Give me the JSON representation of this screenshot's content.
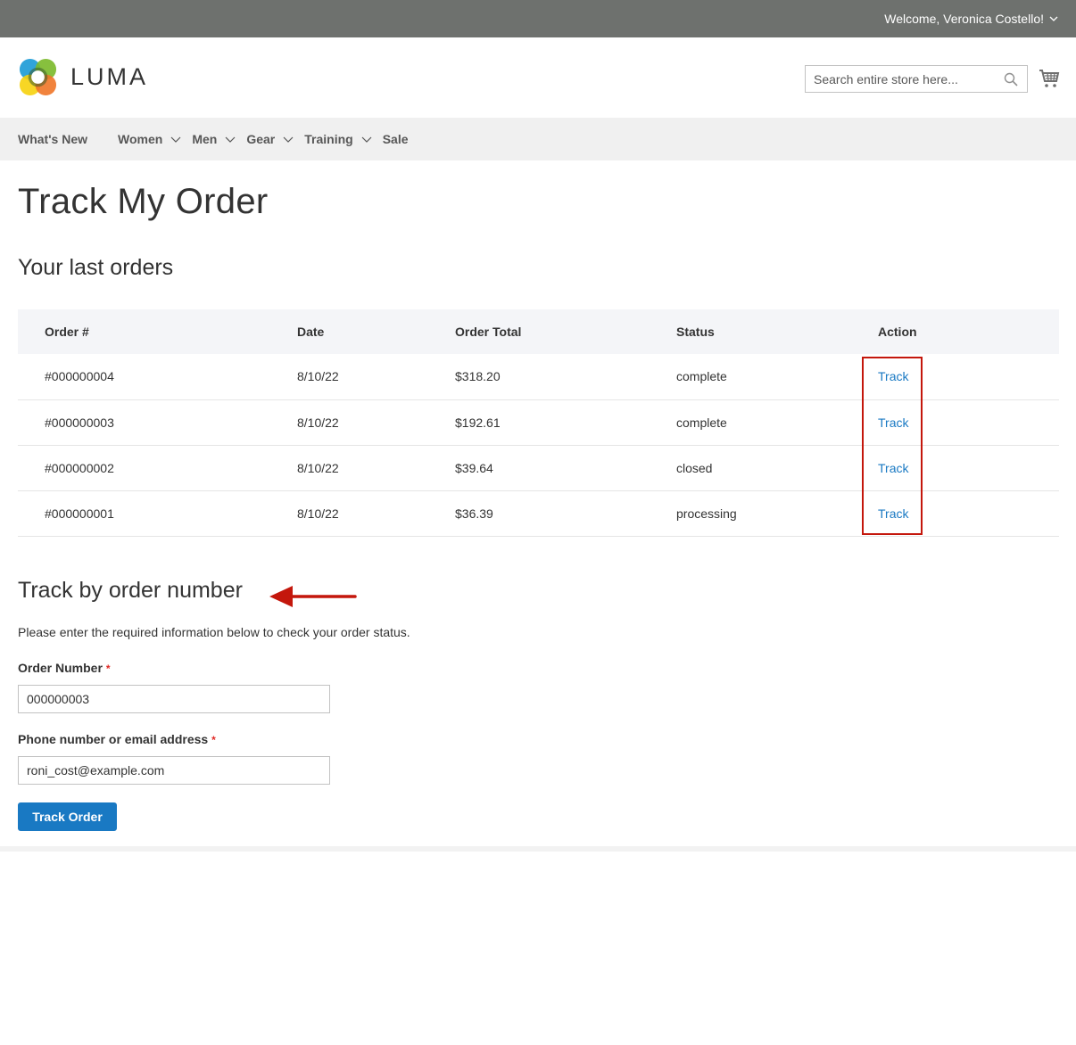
{
  "topbar": {
    "welcome": "Welcome, Veronica Costello!"
  },
  "header": {
    "logo_text": "LUMA",
    "search_placeholder": "Search entire store here...",
    "icons": {
      "search": "search-icon",
      "cart": "cart-icon",
      "account_menu": "chevron-down-icon"
    }
  },
  "nav": {
    "items": [
      {
        "label": "What's New",
        "has_dropdown": false
      },
      {
        "label": "Women",
        "has_dropdown": true
      },
      {
        "label": "Men",
        "has_dropdown": true
      },
      {
        "label": "Gear",
        "has_dropdown": true
      },
      {
        "label": "Training",
        "has_dropdown": true
      },
      {
        "label": "Sale",
        "has_dropdown": false
      }
    ]
  },
  "page": {
    "title": "Track My Order",
    "last_orders_title": "Your last orders",
    "orders_table": {
      "columns": [
        "Order #",
        "Date",
        "Order Total",
        "Status",
        "Action"
      ],
      "rows": [
        {
          "order": "#000000004",
          "date": "8/10/22",
          "total": "$318.20",
          "status": "complete",
          "action": "Track"
        },
        {
          "order": "#000000003",
          "date": "8/10/22",
          "total": "$192.61",
          "status": "complete",
          "action": "Track"
        },
        {
          "order": "#000000002",
          "date": "8/10/22",
          "total": "$39.64",
          "status": "closed",
          "action": "Track"
        },
        {
          "order": "#000000001",
          "date": "8/10/22",
          "total": "$36.39",
          "status": "processing",
          "action": "Track"
        }
      ]
    },
    "track_form": {
      "title": "Track by order number",
      "intro": "Please enter the required information below to check your order status.",
      "order_number_label": "Order Number",
      "order_number_value": "000000003",
      "contact_label": "Phone number or email address",
      "contact_value": "roni_cost@example.com",
      "required_marker": "*",
      "submit_label": "Track Order"
    }
  },
  "annotations": {
    "highlight_color": "#c4170c",
    "arrow_color": "#c4170c"
  },
  "colors": {
    "topbar": "#6e716e",
    "nav_bg": "#f0f0f0",
    "primary": "#1979c3",
    "table_header_bg": "#f4f5f8"
  }
}
